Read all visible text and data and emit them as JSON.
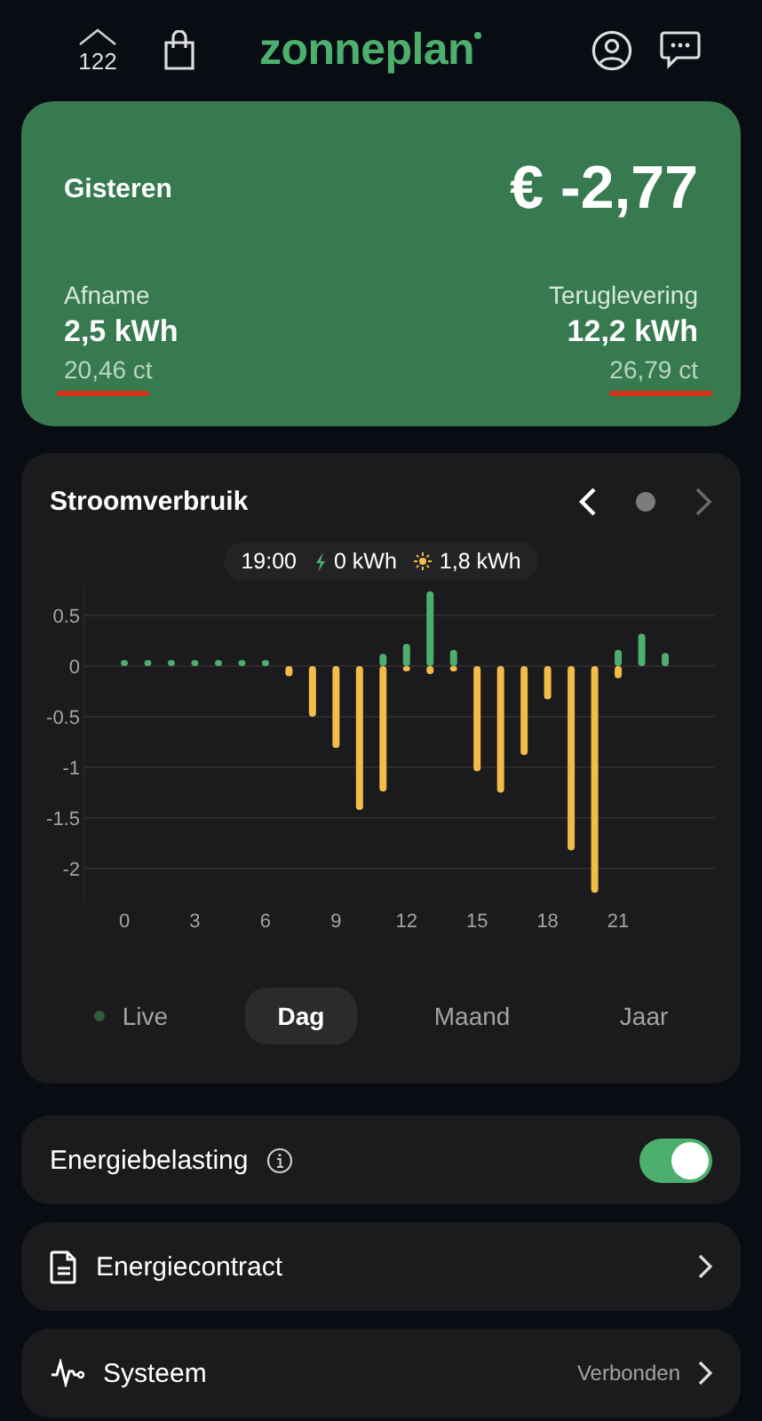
{
  "header": {
    "home_badge": "122",
    "logo": "zonneplan"
  },
  "summary": {
    "period": "Gisteren",
    "total": "€ -2,77",
    "left": {
      "label": "Afname",
      "amount": "2,5 kWh",
      "price": "20,46 ct"
    },
    "right": {
      "label": "Teruglevering",
      "amount": "12,2 kWh",
      "price": "26,79 ct"
    }
  },
  "usage": {
    "title": "Stroomverbruik",
    "next_disabled": true,
    "tooltip": {
      "time": "19:00",
      "import": "0 kWh",
      "export": "1,8 kWh"
    },
    "chart_data": {
      "type": "bar",
      "x": [
        0,
        1,
        2,
        3,
        4,
        5,
        6,
        7,
        8,
        9,
        10,
        11,
        12,
        13,
        14,
        15,
        16,
        17,
        18,
        19,
        20,
        21,
        22,
        23
      ],
      "series": [
        {
          "color": "#4caf6e",
          "values": [
            0.06,
            0.06,
            0.06,
            0.06,
            0.06,
            0.06,
            0.06,
            0,
            0,
            0,
            0,
            0.12,
            0.22,
            0.74,
            0.16,
            0,
            0,
            0,
            0,
            0,
            0,
            0.16,
            0.32,
            0.13
          ]
        },
        {
          "color": "#f2bb4a",
          "values": [
            0,
            0,
            0,
            0,
            0,
            0,
            0,
            -0.1,
            -0.5,
            -0.81,
            -1.42,
            -1.24,
            -0.05,
            -0.08,
            -0.05,
            -1.04,
            -1.25,
            -0.88,
            -0.33,
            -1.82,
            -2.24,
            -0.12,
            0,
            0
          ]
        }
      ],
      "grid": true,
      "xlim": [
        -1.7,
        25.1
      ],
      "ylim": [
        -2.3,
        0.8
      ],
      "yticks": [
        {
          "value": 0.5,
          "label": "0.5"
        },
        0,
        {
          "value": -0.5,
          "label": "-0.5"
        },
        -1,
        {
          "value": -1.5,
          "label": "-1.5"
        },
        -2
      ],
      "xticks": [
        0,
        3,
        6,
        9,
        12,
        15,
        18,
        21
      ],
      "stacked": true
    },
    "tabs": [
      {
        "label": "Live",
        "kind": "live",
        "selected": false
      },
      {
        "label": "Dag",
        "kind": "plain",
        "selected": true
      },
      {
        "label": "Maand",
        "kind": "plain",
        "selected": false
      },
      {
        "label": "Jaar",
        "kind": "plain",
        "selected": false
      }
    ]
  },
  "settings": [
    {
      "kind": "toggle",
      "label": "Energiebelasting",
      "on": true
    },
    {
      "kind": "link",
      "label": "Energiecontract"
    },
    {
      "kind": "link",
      "label": "Systeem",
      "status": "Verbonden"
    }
  ]
}
